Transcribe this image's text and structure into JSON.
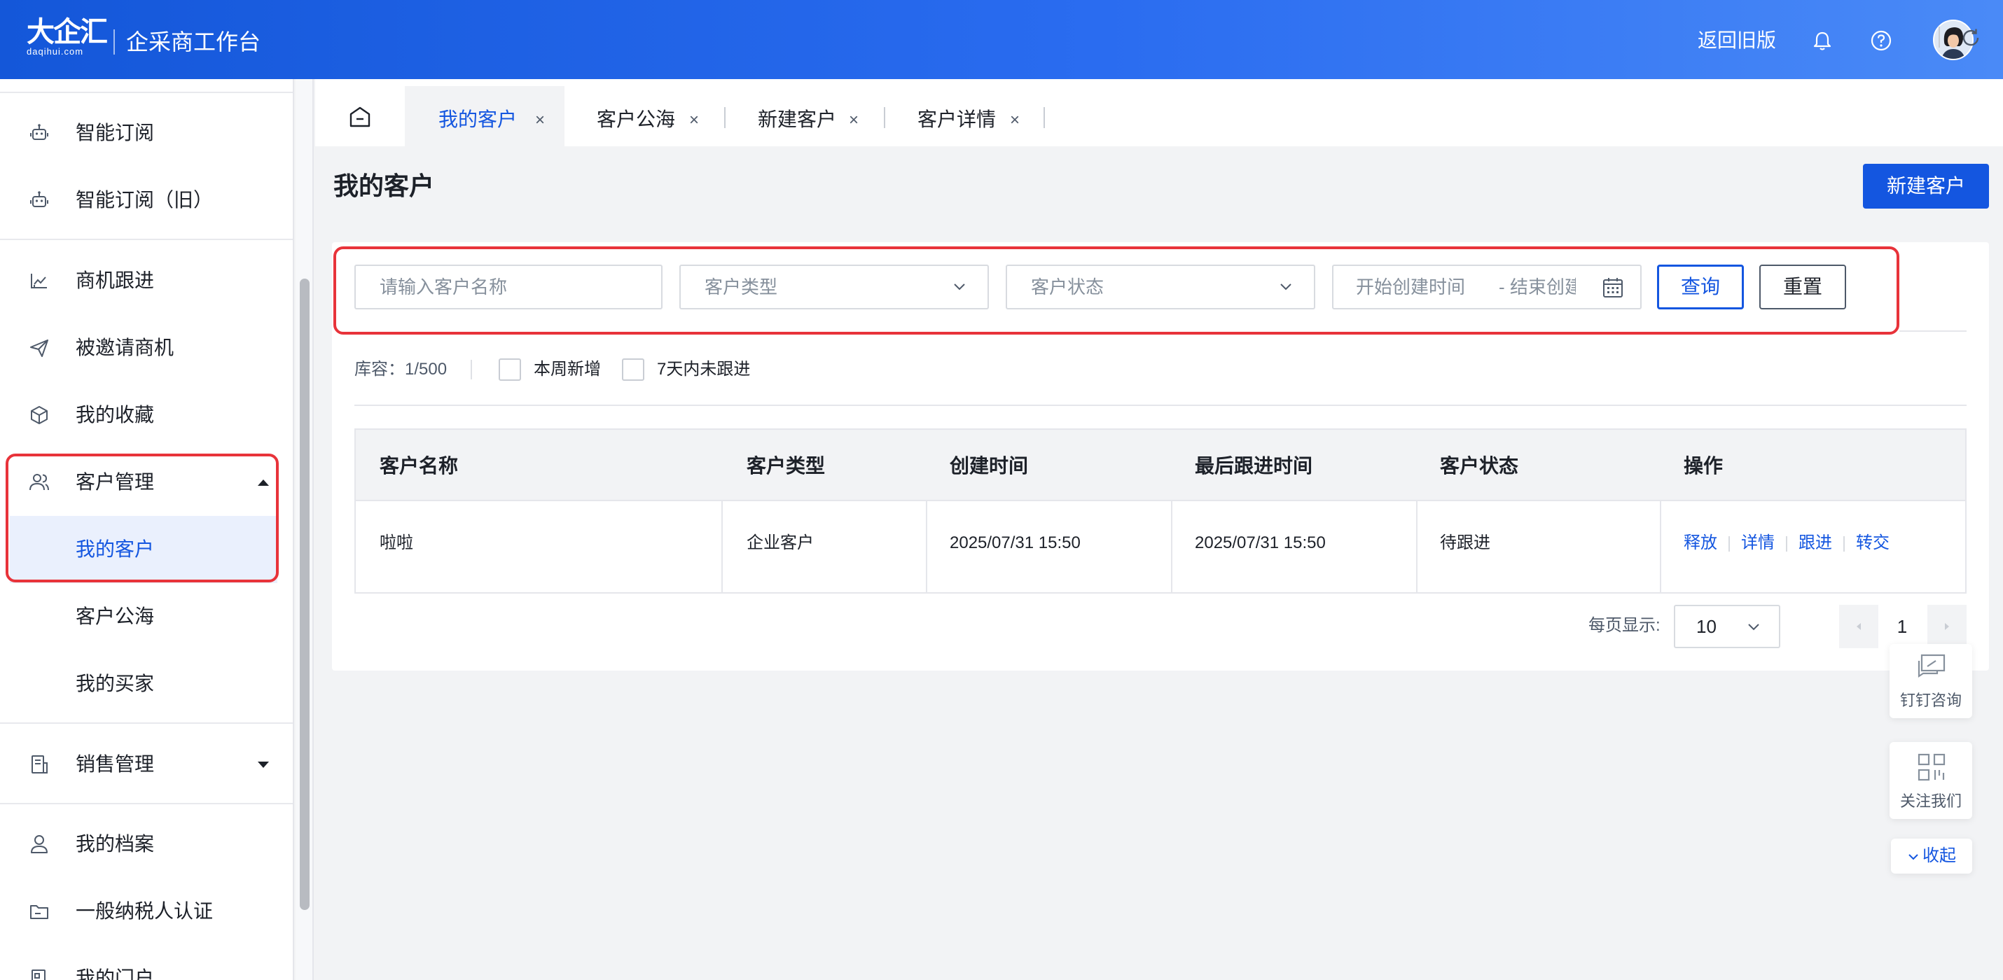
{
  "header": {
    "logo_cn": "大企汇",
    "logo_en": "daqihui.com",
    "app_title": "企采商工作台",
    "old_version": "返回旧版",
    "icons": [
      "bell-icon",
      "help-icon"
    ]
  },
  "sidebar": {
    "items": [
      {
        "label": "智能订阅",
        "icon": "robot-icon"
      },
      {
        "label": "智能订阅（旧）",
        "icon": "robot-icon"
      },
      {
        "label": "商机跟进",
        "icon": "chart-icon"
      },
      {
        "label": "被邀请商机",
        "icon": "send-icon"
      },
      {
        "label": "我的收藏",
        "icon": "box-icon"
      },
      {
        "label": "客户管理",
        "icon": "users-icon",
        "expanded": true
      },
      {
        "label": "我的客户",
        "active": true
      },
      {
        "label": "客户公海"
      },
      {
        "label": "我的买家"
      },
      {
        "label": "销售管理",
        "icon": "document-icon",
        "expanded": false
      },
      {
        "label": "我的档案",
        "icon": "user-icon"
      },
      {
        "label": "一般纳税人认证",
        "icon": "folder-icon"
      },
      {
        "label": "我的门户",
        "icon": "portal-icon"
      }
    ]
  },
  "tabs": [
    {
      "label": "我的客户",
      "close": "×",
      "active": true
    },
    {
      "label": "客户公海",
      "close": "×"
    },
    {
      "label": "新建客户",
      "close": "×"
    },
    {
      "label": "客户详情",
      "close": "×"
    }
  ],
  "page": {
    "title": "我的客户",
    "new_button": "新建客户"
  },
  "filters": {
    "name_placeholder": "请输入客户名称",
    "type_placeholder": "客户类型",
    "status_placeholder": "客户状态",
    "start_placeholder": "开始创建时间",
    "date_sep": "-",
    "end_placeholder": "结束创建时",
    "query_button": "查询",
    "reset_button": "重置"
  },
  "toolbar": {
    "capacity": "库容：1/500",
    "week_new": "本周新增",
    "not_followed": "7天内未跟进"
  },
  "table": {
    "headers": [
      "客户名称",
      "客户类型",
      "创建时间",
      "最后跟进时间",
      "客户状态",
      "操作"
    ],
    "rows": [
      {
        "name": "啦啦",
        "type": "企业客户",
        "created": "2025/07/31 15:50",
        "last_follow": "2025/07/31 15:50",
        "status": "待跟进",
        "actions": [
          "释放",
          "详情",
          "跟进",
          "转交"
        ]
      }
    ]
  },
  "pagination": {
    "per_page_label": "每页显示:",
    "per_page_value": "10",
    "current_page": "1"
  },
  "floating": {
    "dingtalk": "钉钉咨询",
    "follow_us": "关注我们",
    "collapse": "收起"
  },
  "colors": {
    "primary": "#1456e0",
    "highlight_red": "#e8333a",
    "header_gradient_start": "#1457d9",
    "header_gradient_end": "#4a8af7"
  }
}
